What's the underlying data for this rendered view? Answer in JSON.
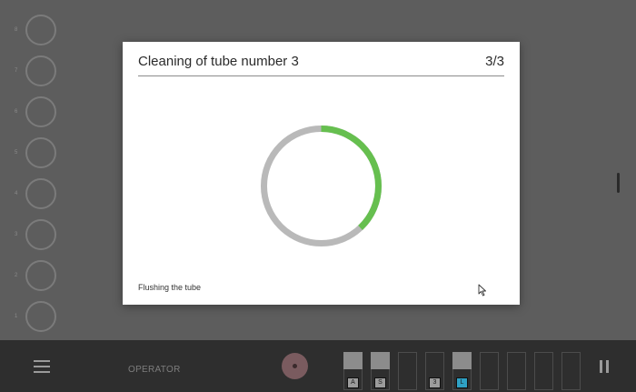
{
  "slots": [
    {
      "num": "8"
    },
    {
      "num": "7"
    },
    {
      "num": "6"
    },
    {
      "num": "5"
    },
    {
      "num": "4"
    },
    {
      "num": "3"
    },
    {
      "num": "2"
    },
    {
      "num": "1"
    }
  ],
  "dialog": {
    "title": "Cleaning of tube number 3",
    "step": "3/3",
    "status": "Flushing the tube",
    "progress": 0.38,
    "progress_color": "#66bf4f",
    "track_color": "#b9b9b9"
  },
  "bottom_bar": {
    "operator_label": "OPERATOR",
    "tube_slots": [
      {
        "tag": "A",
        "filled": true,
        "blue": false
      },
      {
        "tag": "S",
        "filled": true,
        "blue": false
      },
      {
        "tag": "",
        "filled": false,
        "blue": false
      },
      {
        "tag": "3",
        "filled": false,
        "blue": false
      },
      {
        "tag": "L",
        "filled": true,
        "blue": true
      },
      {
        "tag": "",
        "filled": false,
        "blue": false
      },
      {
        "tag": "",
        "filled": false,
        "blue": false
      },
      {
        "tag": "",
        "filled": false,
        "blue": false
      },
      {
        "tag": "",
        "filled": false,
        "blue": false
      }
    ]
  },
  "icons": {
    "menu": "hamburger-menu-icon",
    "record": "record-icon",
    "pause": "pause-icon",
    "cursor": "mouse-pointer-icon"
  }
}
